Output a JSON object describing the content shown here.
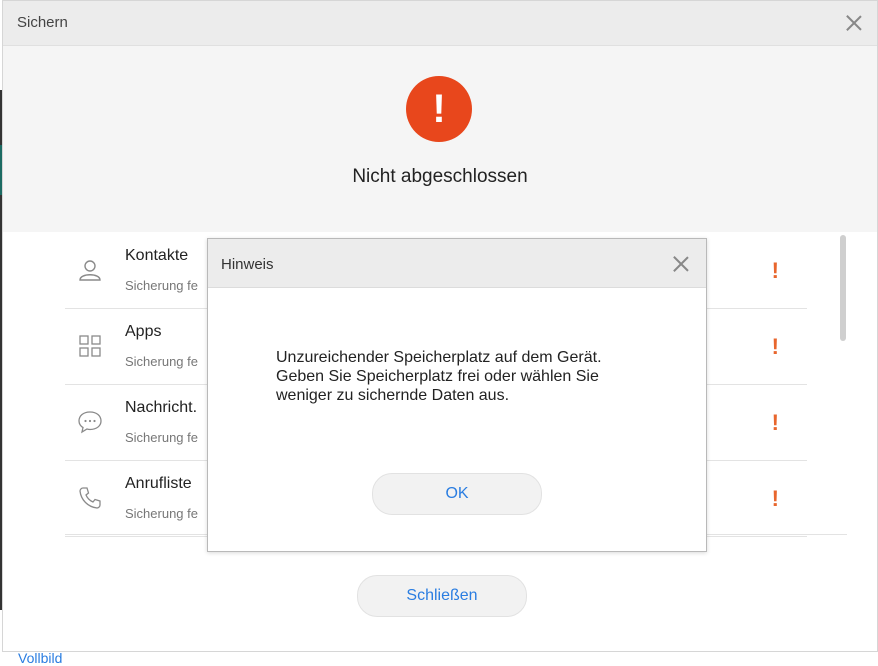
{
  "window": {
    "title": "Sichern",
    "status_icon": "exclamation-icon",
    "status_text": "Nicht abgeschlossen",
    "accent_color": "#e8471c"
  },
  "list": {
    "items": [
      {
        "title": "Kontakte",
        "subtitle": "Sicherung fe",
        "icon": "person-icon",
        "warn": "!"
      },
      {
        "title": "Apps",
        "subtitle": "Sicherung fe",
        "icon": "grid-icon",
        "warn": "!"
      },
      {
        "title": "Nachricht.",
        "subtitle": "Sicherung fe",
        "icon": "chat-bubble-icon",
        "warn": "!"
      },
      {
        "title": "Anrufliste",
        "subtitle": "Sicherung fe",
        "icon": "phone-icon",
        "warn": "!"
      }
    ]
  },
  "footer": {
    "close_label": "Schließen"
  },
  "dialog": {
    "title": "Hinweis",
    "message_lines": [
      "Unzureichender Speicherplatz auf dem Gerät.",
      "Geben Sie Speicherplatz frei oder wählen Sie",
      "weniger zu sichernde Daten aus."
    ],
    "ok_label": "OK"
  },
  "background": {
    "partial_link_text": "Vollbild"
  }
}
